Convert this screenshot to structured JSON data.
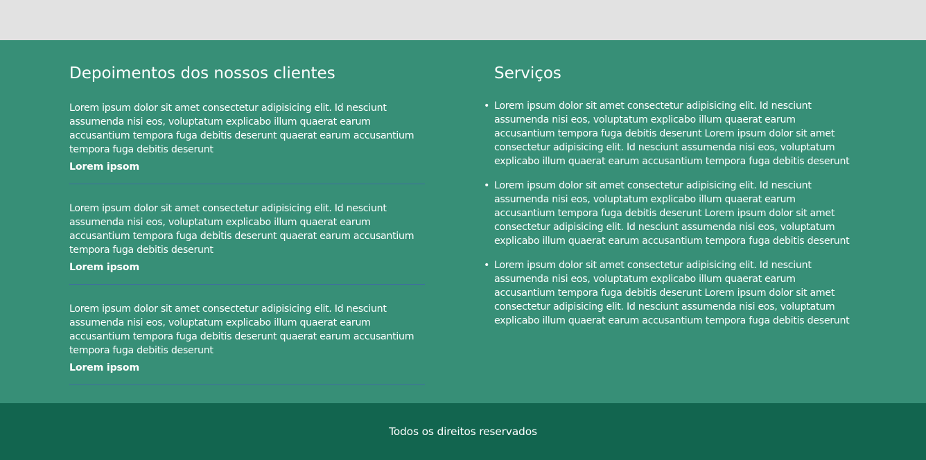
{
  "testimonials": {
    "title": "Depoimentos dos nossos clientes",
    "items": [
      {
        "text": "Lorem ipsum dolor sit amet consectetur adipisicing elit. Id nesciunt assumenda nisi eos, voluptatum explicabo illum quaerat earum accusantium tempora fuga debitis deserunt quaerat earum accusantium tempora fuga debitis deserunt",
        "author": "Lorem ipsom"
      },
      {
        "text": "Lorem ipsum dolor sit amet consectetur adipisicing elit. Id nesciunt assumenda nisi eos, voluptatum explicabo illum quaerat earum accusantium tempora fuga debitis deserunt quaerat earum accusantium tempora fuga debitis deserunt",
        "author": "Lorem ipsom"
      },
      {
        "text": "Lorem ipsum dolor sit amet consectetur adipisicing elit. Id nesciunt assumenda nisi eos, voluptatum explicabo illum quaerat earum accusantium tempora fuga debitis deserunt quaerat earum accusantium tempora fuga debitis deserunt",
        "author": "Lorem ipsom"
      }
    ]
  },
  "services": {
    "title": "Serviços",
    "bullet": "•",
    "items": [
      "Lorem ipsum dolor sit amet consectetur adipisicing elit. Id nesciunt assumenda nisi eos, voluptatum explicabo illum quaerat earum accusantium tempora fuga debitis deserunt Lorem ipsum dolor sit amet consectetur adipisicing elit. Id nesciunt assumenda nisi eos, voluptatum explicabo illum quaerat earum accusantium tempora fuga debitis deserunt",
      "Lorem ipsum dolor sit amet consectetur adipisicing elit. Id nesciunt assumenda nisi eos, voluptatum explicabo illum quaerat earum accusantium tempora fuga debitis deserunt Lorem ipsum dolor sit amet consectetur adipisicing elit. Id nesciunt assumenda nisi eos, voluptatum explicabo illum quaerat earum accusantium tempora fuga debitis deserunt",
      "Lorem ipsum dolor sit amet consectetur adipisicing elit. Id nesciunt assumenda nisi eos, voluptatum explicabo illum quaerat earum accusantium tempora fuga debitis deserunt Lorem ipsum dolor sit amet consectetur adipisicing elit. Id nesciunt assumenda nisi eos, voluptatum explicabo illum quaerat earum accusantium tempora fuga debitis deserunt"
    ]
  },
  "footer": {
    "text": "Todos os direitos reservados"
  },
  "colors": {
    "top_band": "#e2e2e2",
    "content_bg": "#378f77",
    "footer_bg": "#12654f",
    "divider": "#3f6f9f",
    "text": "#ffffff"
  }
}
